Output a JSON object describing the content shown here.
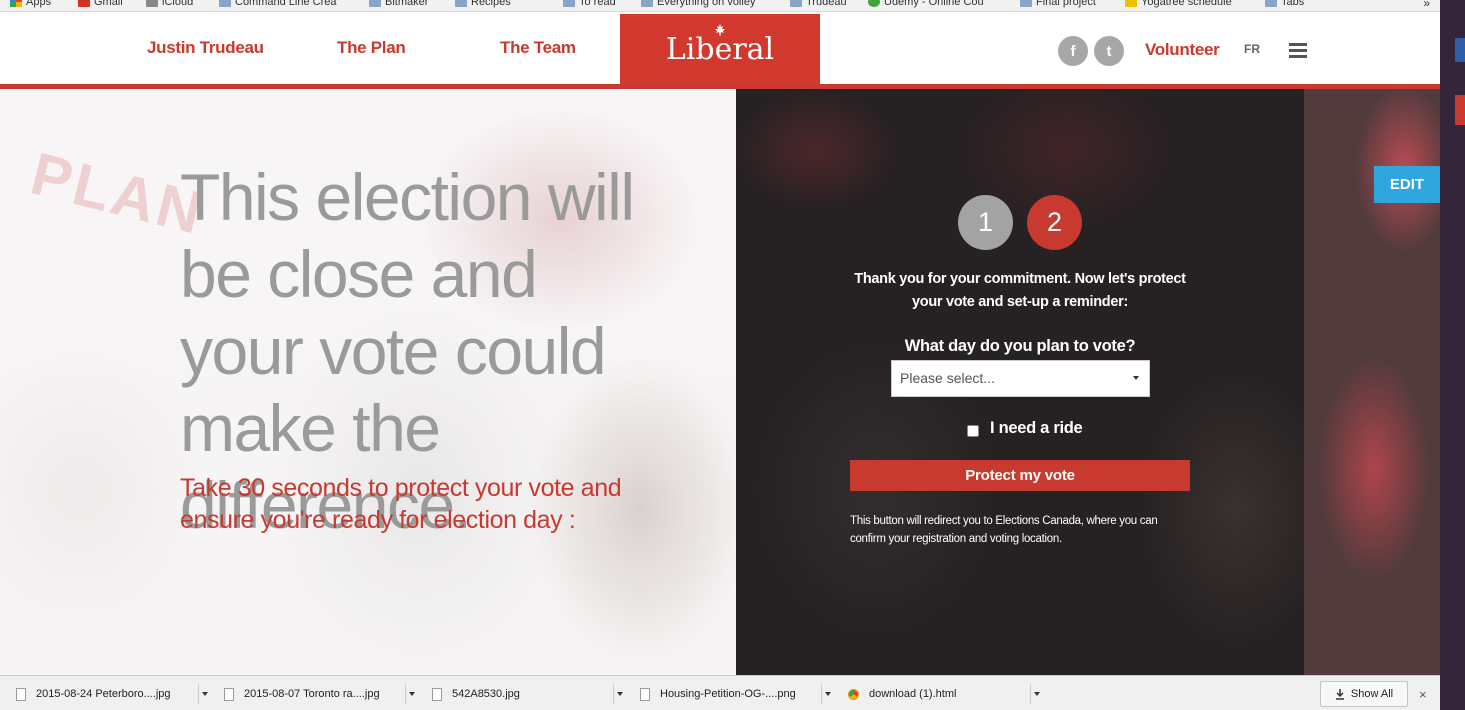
{
  "bookmarks": {
    "items": [
      {
        "label": "Apps",
        "icon": "apps-icon"
      },
      {
        "label": "Gmail",
        "icon": "gmail-icon"
      },
      {
        "label": "iCloud",
        "icon": "apple-icon"
      },
      {
        "label": "Command Line Crea",
        "icon": "folder-icon"
      },
      {
        "label": "Bitmaker",
        "icon": "folder-icon"
      },
      {
        "label": "Recipes",
        "icon": "folder-icon"
      },
      {
        "label": "To read",
        "icon": "folder-icon"
      },
      {
        "label": "Everything on volley",
        "icon": "folder-icon"
      },
      {
        "label": "Trudeau",
        "icon": "folder-icon"
      },
      {
        "label": "Udemy - Online Cou",
        "icon": "udemy-icon"
      },
      {
        "label": "Final project",
        "icon": "folder-icon"
      },
      {
        "label": "Yogatree schedule",
        "icon": "yogatree-icon"
      },
      {
        "label": "Tabs",
        "icon": "folder-icon"
      }
    ],
    "more": "»"
  },
  "nav": {
    "links": [
      "Justin Trudeau",
      "The Plan",
      "The Team"
    ],
    "logo": "Liberal",
    "facebook": "f",
    "twitter": "t",
    "volunteer": "Volunteer",
    "lang": "FR"
  },
  "hero": {
    "watermark": "PLAN",
    "headline": "This election will be close and your vote could make the difference.",
    "subhead": "Take 30 seconds to protect your vote and ensure you're ready for election day :"
  },
  "form": {
    "steps": [
      "1",
      "2"
    ],
    "active_step": 2,
    "thanks": "Thank you for your commitment. Now let's protect your vote and set-up a reminder:",
    "question": "What day do you plan to vote?",
    "select_value": "Please select...",
    "ride_label": "I need a ride",
    "ride_checked": false,
    "button": "Protect my vote",
    "note": "This button will redirect you to Elections Canada, where you can confirm your registration and voting location."
  },
  "edit": {
    "label": "EDIT"
  },
  "downloads": {
    "files": [
      "2015-08-24 Peterboro....jpg",
      "2015-08-07 Toronto ra....jpg",
      "542A8530.jpg",
      "Housing-Petition-OG-....png",
      "download (1).html"
    ],
    "show_all": "Show All",
    "close": "×"
  },
  "colors": {
    "brand_red": "#c8392f",
    "edit_blue": "#2fa6dd",
    "step_inactive": "#a3a3a3"
  }
}
